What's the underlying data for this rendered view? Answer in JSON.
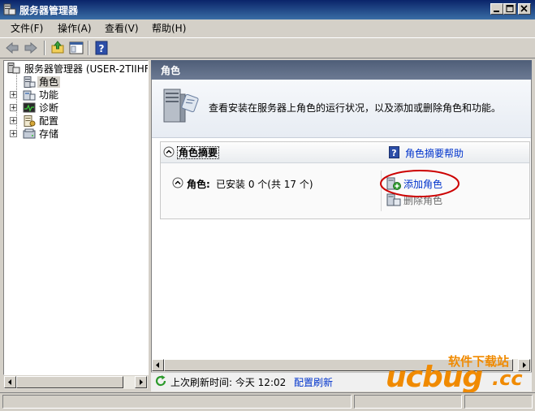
{
  "window": {
    "title": "服务器管理器"
  },
  "menu": [
    "文件(F)",
    "操作(A)",
    "查看(V)",
    "帮助(H)"
  ],
  "tree": {
    "root": "服务器管理器 (USER-2TIIHF",
    "items": [
      {
        "label": "角色",
        "icon": "roles-icon",
        "selected": true,
        "expandable": false
      },
      {
        "label": "功能",
        "icon": "features-icon",
        "selected": false,
        "expandable": true
      },
      {
        "label": "诊断",
        "icon": "diagnostics-icon",
        "selected": false,
        "expandable": true
      },
      {
        "label": "配置",
        "icon": "configuration-icon",
        "selected": false,
        "expandable": true
      },
      {
        "label": "存储",
        "icon": "storage-icon",
        "selected": false,
        "expandable": true
      }
    ],
    "expander_symbol": "+"
  },
  "content": {
    "header": "角色",
    "intro": "查看安装在服务器上角色的运行状况，以及添加或删除角色和功能。",
    "summary_title": "角色摘要",
    "summary_help": "角色摘要帮助",
    "roles_label": "角色:",
    "roles_status": "已安装 0 个(共 17 个)",
    "add_roles": "添加角色",
    "remove_roles": "删除角色",
    "refresh_text": "上次刷新时间: 今天 12:02",
    "refresh_link": "配置刷新"
  },
  "watermark": {
    "brand": "ucbug",
    "suffix": ".cc",
    "site_cn": "软件下载站"
  },
  "colors": {
    "header_bg": "#5b6a84",
    "link": "#0033cc",
    "highlight_circle": "#cc0000",
    "watermark_orange": "#f08a00"
  }
}
